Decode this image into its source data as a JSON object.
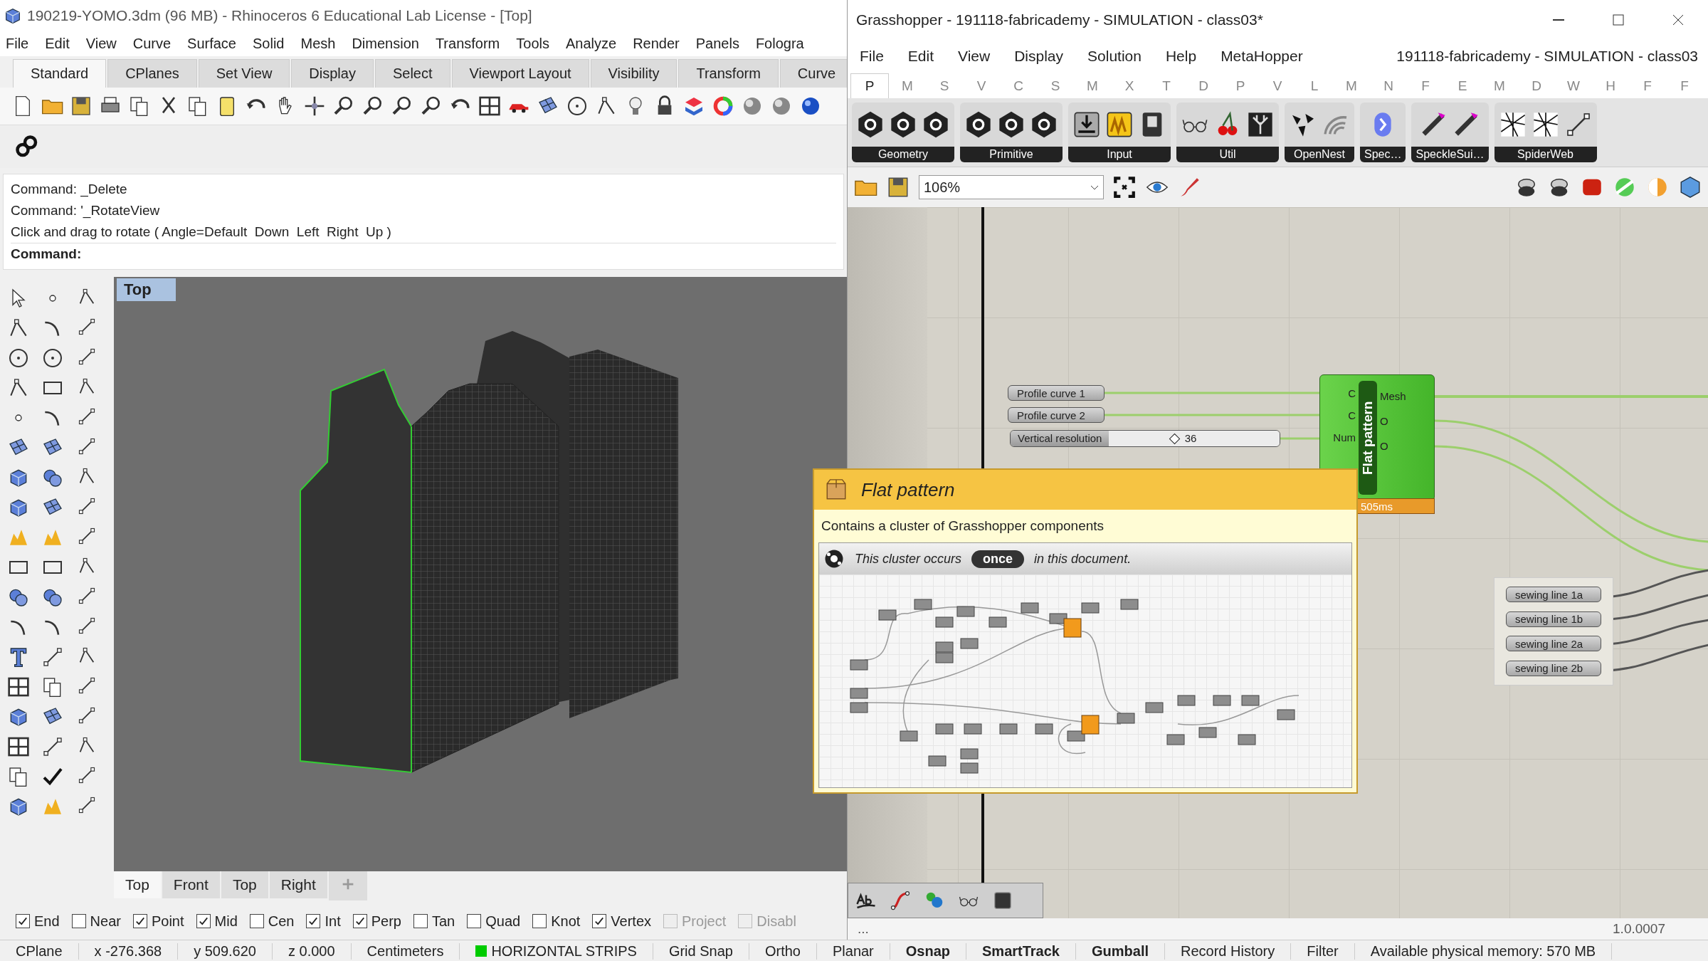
{
  "rhino": {
    "title": "190219-YOMO.3dm (96 MB) - Rhinoceros 6 Educational Lab License - [Top]",
    "menu": [
      "File",
      "Edit",
      "View",
      "Curve",
      "Surface",
      "Solid",
      "Mesh",
      "Dimension",
      "Transform",
      "Tools",
      "Analyze",
      "Render",
      "Panels",
      "Fologra"
    ],
    "toolbar_tabs": [
      {
        "label": "Standard",
        "selected": true
      },
      {
        "label": "CPlanes",
        "selected": false
      },
      {
        "label": "Set View",
        "selected": false
      },
      {
        "label": "Display",
        "selected": false
      },
      {
        "label": "Select",
        "selected": false
      },
      {
        "label": "Viewport Layout",
        "selected": false
      },
      {
        "label": "Visibility",
        "selected": false
      },
      {
        "label": "Transform",
        "selected": false
      },
      {
        "label": "Curve",
        "selected": false
      }
    ],
    "command_history": [
      "Command: _Delete",
      "Command: '_RotateView",
      "Click and drag to rotate ( Angle=Default  Down  Left  Right  Up )"
    ],
    "command_prompt": "Command:",
    "viewport": {
      "title": "Top"
    },
    "viewport_tabs": [
      {
        "label": "Top",
        "selected": true
      },
      {
        "label": "Front",
        "selected": false
      },
      {
        "label": "Top",
        "selected": false
      },
      {
        "label": "Right",
        "selected": false
      }
    ],
    "osnaps": [
      {
        "label": "End",
        "checked": true,
        "disabled": false
      },
      {
        "label": "Near",
        "checked": false,
        "disabled": false
      },
      {
        "label": "Point",
        "checked": true,
        "disabled": false
      },
      {
        "label": "Mid",
        "checked": true,
        "disabled": false
      },
      {
        "label": "Cen",
        "checked": false,
        "disabled": false
      },
      {
        "label": "Int",
        "checked": true,
        "disabled": false
      },
      {
        "label": "Perp",
        "checked": true,
        "disabled": false
      },
      {
        "label": "Tan",
        "checked": false,
        "disabled": false
      },
      {
        "label": "Quad",
        "checked": false,
        "disabled": false
      },
      {
        "label": "Knot",
        "checked": false,
        "disabled": false
      },
      {
        "label": "Vertex",
        "checked": true,
        "disabled": false
      },
      {
        "label": "Project",
        "checked": false,
        "disabled": true
      },
      {
        "label": "Disabl",
        "checked": false,
        "disabled": true
      }
    ],
    "status_bar": [
      {
        "kind": "text",
        "label": "CPlane"
      },
      {
        "kind": "text",
        "label": "x -276.368"
      },
      {
        "kind": "text",
        "label": "y 509.620"
      },
      {
        "kind": "text",
        "label": "z 0.000"
      },
      {
        "kind": "text",
        "label": "Centimeters"
      },
      {
        "kind": "layer",
        "label": "HORIZONTAL STRIPS",
        "color": "#00cc00"
      },
      {
        "kind": "toggle",
        "label": "Grid Snap",
        "on": false
      },
      {
        "kind": "toggle",
        "label": "Ortho",
        "on": false
      },
      {
        "kind": "toggle",
        "label": "Planar",
        "on": false
      },
      {
        "kind": "toggle",
        "label": "Osnap",
        "on": true
      },
      {
        "kind": "toggle",
        "label": "SmartTrack",
        "on": true
      },
      {
        "kind": "toggle",
        "label": "Gumball",
        "on": true
      },
      {
        "kind": "toggle",
        "label": "Record History",
        "on": false
      },
      {
        "kind": "toggle",
        "label": "Filter",
        "on": false
      },
      {
        "kind": "text",
        "label": "Available physical memory: 570 MB"
      }
    ]
  },
  "grasshopper": {
    "title": "Grasshopper - 191118-fabricademy - SIMULATION - class03*",
    "menu": [
      "File",
      "Edit",
      "View",
      "Display",
      "Solution",
      "Help",
      "MetaHopper"
    ],
    "document_name": "191118-fabricademy - SIMULATION - class03",
    "category_tabs": [
      {
        "label": "P",
        "selected": true
      },
      {
        "label": "M",
        "selected": false
      },
      {
        "label": "S",
        "selected": false
      },
      {
        "label": "V",
        "selected": false
      },
      {
        "label": "C",
        "selected": false
      },
      {
        "label": "S",
        "selected": false
      },
      {
        "label": "M",
        "selected": false
      },
      {
        "label": "X",
        "selected": false
      },
      {
        "label": "T",
        "selected": false
      },
      {
        "label": "D",
        "selected": false
      },
      {
        "label": "P",
        "selected": false
      },
      {
        "label": "V",
        "selected": false
      },
      {
        "label": "L",
        "selected": false
      },
      {
        "label": "M",
        "selected": false
      },
      {
        "label": "N",
        "selected": false
      },
      {
        "label": "F",
        "selected": false
      },
      {
        "label": "E",
        "selected": false
      },
      {
        "label": "M",
        "selected": false
      },
      {
        "label": "D",
        "selected": false
      },
      {
        "label": "W",
        "selected": false
      },
      {
        "label": "H",
        "selected": false
      },
      {
        "label": "F",
        "selected": false
      },
      {
        "label": "F",
        "selected": false
      }
    ],
    "panels": [
      "Geometry",
      "Primitive",
      "Input",
      "Util",
      "OpenNest",
      "Spec…",
      "SpeckleSui…",
      "SpiderWeb"
    ],
    "zoom": "106%",
    "canvas": {
      "params": [
        "Profile curve 1",
        "Profile curve 2"
      ],
      "slider": {
        "label": "Vertical resolution",
        "value": "36",
        "level": 0.36
      },
      "component": {
        "name": "Flat pattern",
        "inputs": [
          "C",
          "C",
          "Num"
        ],
        "outputs": [
          "Mesh",
          "O",
          "O"
        ],
        "timing": "505ms"
      },
      "group": [
        "sewing line 1a",
        "sewing line 1b",
        "sewing line 2a",
        "sewing line 2b"
      ]
    },
    "tooltip": {
      "title": "Flat pattern",
      "description": "Contains a cluster of Grasshopper components",
      "occurs_before": "This cluster occurs",
      "occurs_count": "once",
      "occurs_after": "in this document."
    },
    "status": {
      "left": "...",
      "version": "1.0.0007"
    }
  }
}
